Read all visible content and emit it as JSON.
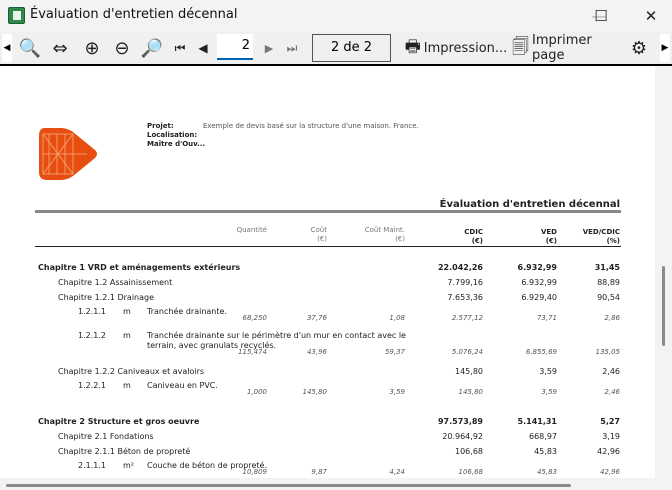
{
  "window": {
    "title": "Évaluation d'entretien décennal",
    "controls": [
      "—",
      "☐",
      "✕"
    ]
  },
  "toolbar": {
    "page_value": "2",
    "page_count": "2 de 2",
    "print_label": "Impression...",
    "print_page_label": "Imprimer page",
    "icons": [
      "zoom-page-icon",
      "page-width-icon",
      "zoom-in-icon",
      "zoom-out-icon",
      "zoom-select-icon",
      "first-page-icon",
      "prev-page-icon",
      "next-page-icon",
      "last-page-icon",
      "printer-icon",
      "print-page-icon",
      "gear-icon"
    ]
  },
  "report": {
    "project_label": "Projet:",
    "project_value": "Exemple de devis basé sur la structure d'une maison. France.",
    "location_label": "Localisation:",
    "owner_label": "Maître d'Ouv...",
    "heading": "Évaluation d'entretien décennal",
    "logo_color": "#e84e0f",
    "columns": {
      "qty": "Quantité",
      "cost": [
        "Coût",
        "(€)"
      ],
      "maint": [
        "Coût Maint.",
        "(€)"
      ],
      "cdic": [
        "CDIC",
        "(€)"
      ],
      "ved": [
        "VED",
        "(€)"
      ],
      "ratio": [
        "VED/CDIC",
        "(%)"
      ]
    },
    "rows": [
      {
        "level": 0,
        "label": "Chapitre 1 VRD et aménagements extérieurs",
        "cdic": "22.042,26",
        "ved": "6.932,99",
        "ratio": "31,45"
      },
      {
        "level": 1,
        "label": "Chapitre 1.2 Assainissement",
        "cdic": "7.799,16",
        "ved": "6.932,99",
        "ratio": "88,89"
      },
      {
        "level": 1,
        "label": "Chapitre 1.2.1 Drainage",
        "cdic": "7.653,36",
        "ved": "6.929,40",
        "ratio": "90,54"
      },
      {
        "level": 2,
        "code": "1.2.1.1",
        "unit": "m",
        "desc": [
          "Tranchée drainante."
        ],
        "qty": "68,250",
        "cost": "37,76",
        "maint": "1,08",
        "cdic": "2.577,12",
        "ved": "73,71",
        "ratio": "2,86"
      },
      {
        "level": 2,
        "code": "1.2.1.2",
        "unit": "m",
        "desc": [
          "Tranchée drainante sur le périmètre d'un mur en contact avec le",
          "terrain, avec granulats recyclés."
        ],
        "qty": "115,474",
        "cost": "43,96",
        "maint": "59,37",
        "cdic": "5.076,24",
        "ved": "6.855,69",
        "ratio": "135,05"
      },
      {
        "level": 1,
        "label": "Chapitre 1.2.2 Caniveaux et avaloirs",
        "cdic": "145,80",
        "ved": "3,59",
        "ratio": "2,46"
      },
      {
        "level": 2,
        "code": "1.2.2.1",
        "unit": "m",
        "desc": [
          "Caniveau en PVC."
        ],
        "qty": "1,000",
        "cost": "145,80",
        "maint": "3,59",
        "cdic": "145,80",
        "ved": "3,59",
        "ratio": "2,46"
      },
      {
        "level": 0,
        "label": "Chapitre 2 Structure et gros oeuvre",
        "cdic": "97.573,89",
        "ved": "5.141,31",
        "ratio": "5,27"
      },
      {
        "level": 1,
        "label": "Chapitre 2.1 Fondations",
        "cdic": "20.964,92",
        "ved": "668,97",
        "ratio": "3,19"
      },
      {
        "level": 1,
        "label": "Chapitre 2.1.1 Béton de propreté",
        "cdic": "106,68",
        "ved": "45,83",
        "ratio": "42,96"
      },
      {
        "level": 2,
        "code": "2.1.1.1",
        "unit": "m²",
        "desc": [
          "Couche de béton de propreté."
        ],
        "qty": "10,809",
        "cost": "9,87",
        "maint": "4,24",
        "cdic": "106,68",
        "ved": "45,83",
        "ratio": "42,96"
      }
    ]
  }
}
